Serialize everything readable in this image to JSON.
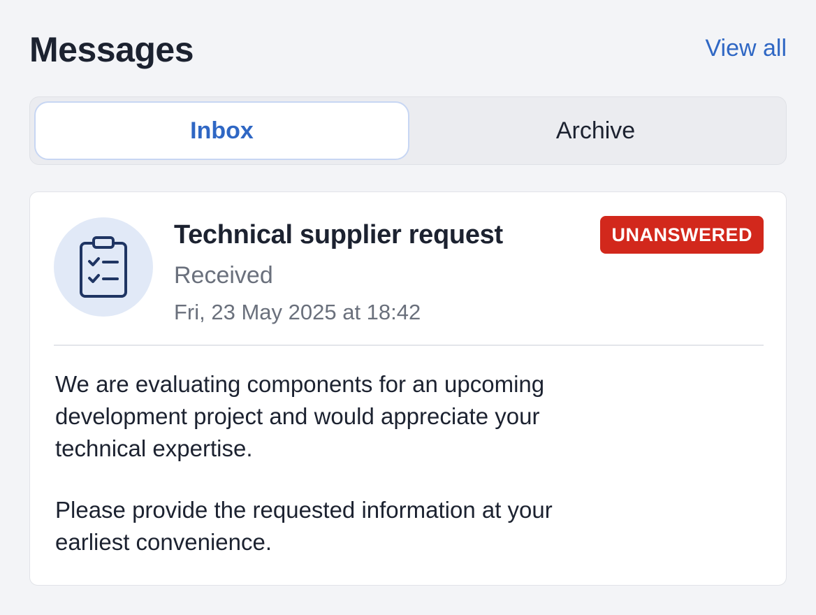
{
  "header": {
    "title": "Messages",
    "view_all_label": "View all"
  },
  "tabs": [
    {
      "label": "Inbox",
      "active": true
    },
    {
      "label": "Archive",
      "active": false
    }
  ],
  "message": {
    "icon": "clipboard-checklist-icon",
    "subject": "Technical supplier request",
    "status_label": "Received",
    "timestamp": "Fri, 23 May 2025 at 18:42",
    "badge": "UNANSWERED",
    "body": [
      "We are evaluating components for an upcoming development project and would appreciate your technical expertise.",
      "Please provide the requested information at your earliest convenience."
    ]
  },
  "colors": {
    "accent": "#2f67c4",
    "badge": "#d2281c",
    "background": "#f3f4f7",
    "avatar_bg": "#e1e9f7"
  }
}
